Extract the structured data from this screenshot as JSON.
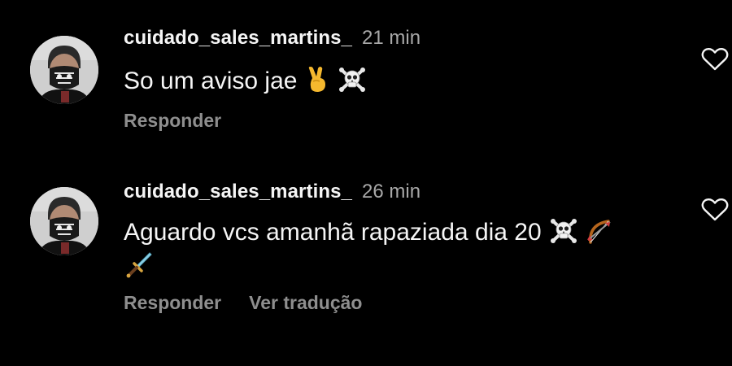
{
  "comments": [
    {
      "username": "cuidado_sales_martins_",
      "timestamp": "21 min",
      "text": "So um aviso jae",
      "emojis": [
        "victory-hand",
        "skull-and-crossbones"
      ],
      "actions": {
        "reply": "Responder"
      },
      "like_icon": "heart-outline-icon"
    },
    {
      "username": "cuidado_sales_martins_",
      "timestamp": "26 min",
      "text": "Aguardo vcs amanhã rapaziada dia 20",
      "emojis": [
        "skull-and-crossbones",
        "bow-and-arrow",
        "dagger"
      ],
      "actions": {
        "reply": "Responder",
        "translate": "Ver tradução"
      },
      "like_icon": "heart-outline-icon"
    }
  ],
  "colors": {
    "background": "#000000",
    "primary_text": "#f5f5f5",
    "secondary_text": "#a8a8a8",
    "action_text": "#8e8e8e"
  }
}
